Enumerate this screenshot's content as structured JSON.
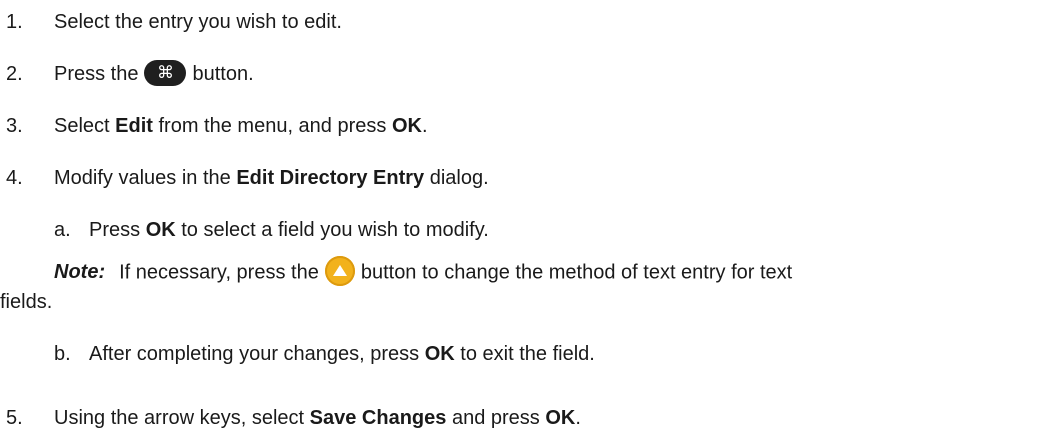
{
  "steps": [
    {
      "number": "1.",
      "text": "Select the entry you wish to edit."
    },
    {
      "number": "2.",
      "before": "Press the",
      "after": "button.",
      "button_icon": "command-key-icon",
      "button_glyph": "⌘"
    },
    {
      "number": "3.",
      "t1": "Select ",
      "b1": "Edit",
      "t2": " from the menu, and press ",
      "b2": "OK",
      "t3": "."
    },
    {
      "number": "4.",
      "t1": "Modify values in the ",
      "b1": "Edit Directory Entry",
      "t2": " dialog."
    },
    {
      "number": "5.",
      "t1": "Using the arrow keys, select ",
      "b1": "Save Changes",
      "t2": " and press ",
      "b2": "OK",
      "t3": "."
    }
  ],
  "substeps": [
    {
      "letter": "a.",
      "t1": "Press ",
      "b1": "OK",
      "t2": " to select a field you wish to modify."
    },
    {
      "letter": "b.",
      "t1": "After completing your changes, press ",
      "b1": "OK",
      "t2": " to exit the field."
    }
  ],
  "note": {
    "label": "Note:",
    "before": "If necessary, press the",
    "after": "button to change the method of text entry for text",
    "continuation": "fields.",
    "button_icon": "up-arrow-button-icon",
    "button_color": "#f2b21c"
  }
}
